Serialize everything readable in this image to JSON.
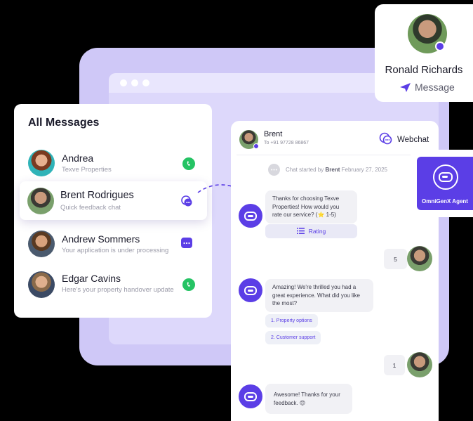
{
  "contact": {
    "name": "Ronald Richards",
    "action": "Message"
  },
  "messages_panel": {
    "title": "All Messages",
    "items": [
      {
        "name": "Andrea",
        "subtitle": "Texve Properties",
        "channel": "whatsapp-icon"
      },
      {
        "name": "Brent Rodrigues",
        "subtitle": "Quick feedback chat",
        "channel": "webchat-icon"
      },
      {
        "name": "Andrew Sommers",
        "subtitle": "Your application is under processing",
        "channel": "chat-icon"
      },
      {
        "name": "Edgar Cavins",
        "subtitle": "Here's your property handover update",
        "channel": "whatsapp-icon"
      }
    ]
  },
  "chat": {
    "header": {
      "name": "Brent",
      "phone": "To +91 97728 86867",
      "channel_label": "Webchat"
    },
    "started": {
      "prefix": "Chat started by",
      "by": "Brent",
      "date": "February 27, 2025"
    },
    "messages": [
      {
        "from": "bot",
        "text": "Thanks for choosing Texve Properties! How would you rate our service? (⭐ 1-5)",
        "button": "Rating"
      },
      {
        "from": "user",
        "text": "5"
      },
      {
        "from": "bot",
        "text": "Amazing! We're thrilled you had a great experience. What did you like the most?",
        "options": [
          "1. Property options",
          "2. Customer support"
        ]
      },
      {
        "from": "user",
        "text": "1"
      },
      {
        "from": "bot",
        "text": "Awesome! Thanks for your feedback. 😊"
      }
    ]
  },
  "agent": {
    "label": "OmniGenX Agent"
  },
  "colors": {
    "accent": "#5b3ee6",
    "whatsapp": "#25c364",
    "background_window": "#cfc8f7"
  }
}
